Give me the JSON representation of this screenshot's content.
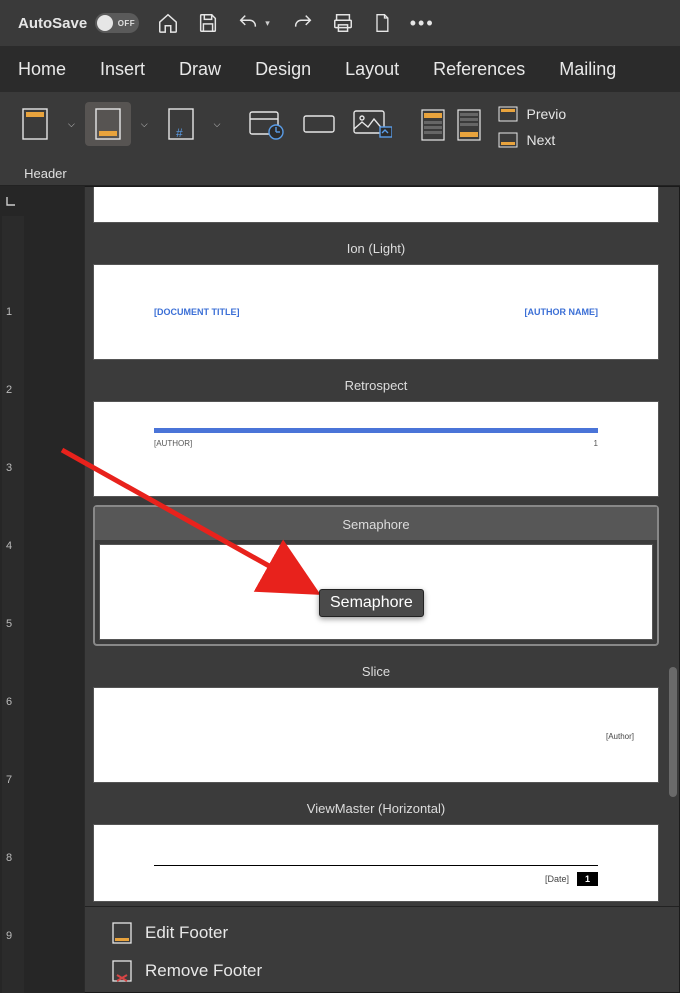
{
  "titlebar": {
    "autosave_label": "AutoSave",
    "autosave_state": "OFF"
  },
  "tabs": {
    "home": "Home",
    "insert": "Insert",
    "draw": "Draw",
    "design": "Design",
    "layout": "Layout",
    "references": "References",
    "mailing": "Mailing"
  },
  "ribbon": {
    "header_label": "Header",
    "previous": "Previo",
    "next": "Next"
  },
  "gallery": {
    "items": {
      "ion_light": {
        "title": "Ion (Light)",
        "left": "[DOCUMENT TITLE]",
        "right": "[AUTHOR NAME]"
      },
      "retrospect": {
        "title": "Retrospect",
        "author": "[AUTHOR]",
        "page": "1"
      },
      "semaphore": {
        "title": "Semaphore"
      },
      "slice": {
        "title": "Slice",
        "author": "[Author]"
      },
      "viewmaster": {
        "title": "ViewMaster (Horizontal)",
        "date": "[Date]",
        "page": "1"
      }
    },
    "footer": {
      "edit": "Edit Footer",
      "remove": "Remove Footer"
    }
  },
  "tooltip": "Semaphore",
  "ruler": {
    "marks": [
      "1",
      "2",
      "3",
      "4",
      "5",
      "6",
      "7",
      "8",
      "9"
    ]
  }
}
